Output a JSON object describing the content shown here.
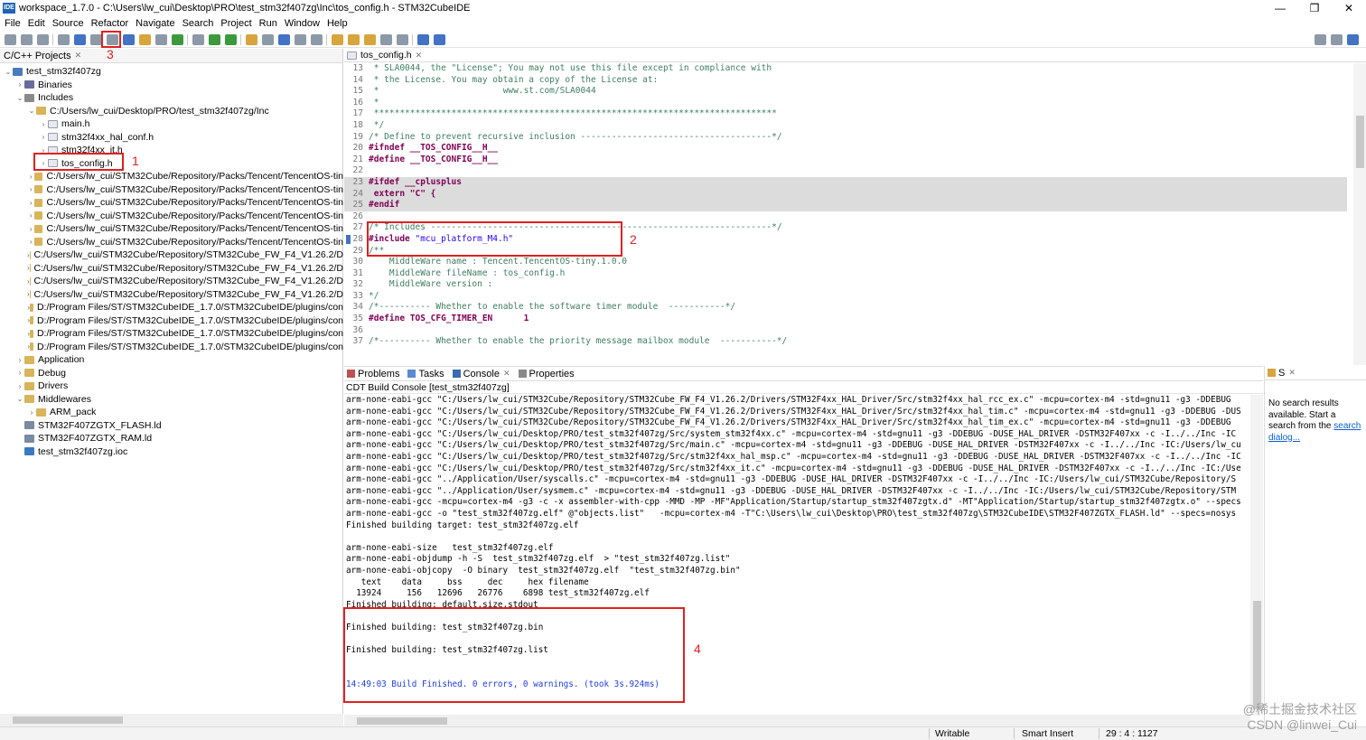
{
  "window": {
    "app_icon": "IDE",
    "title": "workspace_1.7.0 - C:\\Users\\lw_cui\\Desktop\\PRO\\test_stm32f407zg\\Inc\\tos_config.h - STM32CubeIDE",
    "minimize": "—",
    "maximize": "❐",
    "close": "✕"
  },
  "menu": [
    "File",
    "Edit",
    "Source",
    "Refactor",
    "Navigate",
    "Search",
    "Project",
    "Run",
    "Window",
    "Help"
  ],
  "project_explorer": {
    "title": "C/C++ Projects",
    "close_glyph": "✕",
    "tree": [
      {
        "label": "test_stm32f407zg",
        "indent": 0,
        "arrow": "⌄",
        "icon": "proj"
      },
      {
        "label": "Binaries",
        "indent": 1,
        "arrow": "›",
        "icon": "bin"
      },
      {
        "label": "Includes",
        "indent": 1,
        "arrow": "⌄",
        "icon": "inc"
      },
      {
        "label": "C:/Users/lw_cui/Desktop/PRO/test_stm32f407zg/Inc",
        "indent": 2,
        "arrow": "⌄",
        "icon": "folder"
      },
      {
        "label": "main.h",
        "indent": 3,
        "arrow": "›",
        "icon": "hfile"
      },
      {
        "label": "stm32f4xx_hal_conf.h",
        "indent": 3,
        "arrow": "›",
        "icon": "hfile"
      },
      {
        "label": "stm32f4xx_it.h",
        "indent": 3,
        "arrow": "›",
        "icon": "hfile"
      },
      {
        "label": "tos_config.h",
        "indent": 3,
        "arrow": "›",
        "icon": "hfile"
      },
      {
        "label": "C:/Users/lw_cui/STM32Cube/Repository/Packs/Tencent/TencentOS-tin",
        "indent": 2,
        "arrow": "›",
        "icon": "folder"
      },
      {
        "label": "C:/Users/lw_cui/STM32Cube/Repository/Packs/Tencent/TencentOS-tin",
        "indent": 2,
        "arrow": "›",
        "icon": "folder"
      },
      {
        "label": "C:/Users/lw_cui/STM32Cube/Repository/Packs/Tencent/TencentOS-tin",
        "indent": 2,
        "arrow": "›",
        "icon": "folder"
      },
      {
        "label": "C:/Users/lw_cui/STM32Cube/Repository/Packs/Tencent/TencentOS-tin",
        "indent": 2,
        "arrow": "›",
        "icon": "folder"
      },
      {
        "label": "C:/Users/lw_cui/STM32Cube/Repository/Packs/Tencent/TencentOS-tin",
        "indent": 2,
        "arrow": "›",
        "icon": "folder"
      },
      {
        "label": "C:/Users/lw_cui/STM32Cube/Repository/Packs/Tencent/TencentOS-tin",
        "indent": 2,
        "arrow": "›",
        "icon": "folder"
      },
      {
        "label": "C:/Users/lw_cui/STM32Cube/Repository/STM32Cube_FW_F4_V1.26.2/D",
        "indent": 2,
        "arrow": "›",
        "icon": "folder"
      },
      {
        "label": "C:/Users/lw_cui/STM32Cube/Repository/STM32Cube_FW_F4_V1.26.2/D",
        "indent": 2,
        "arrow": "›",
        "icon": "folder"
      },
      {
        "label": "C:/Users/lw_cui/STM32Cube/Repository/STM32Cube_FW_F4_V1.26.2/D",
        "indent": 2,
        "arrow": "›",
        "icon": "folder"
      },
      {
        "label": "C:/Users/lw_cui/STM32Cube/Repository/STM32Cube_FW_F4_V1.26.2/D",
        "indent": 2,
        "arrow": "›",
        "icon": "folder"
      },
      {
        "label": "D:/Program Files/ST/STM32CubeIDE_1.7.0/STM32CubeIDE/plugins/con",
        "indent": 2,
        "arrow": "›",
        "icon": "folder"
      },
      {
        "label": "D:/Program Files/ST/STM32CubeIDE_1.7.0/STM32CubeIDE/plugins/con",
        "indent": 2,
        "arrow": "›",
        "icon": "folder"
      },
      {
        "label": "D:/Program Files/ST/STM32CubeIDE_1.7.0/STM32CubeIDE/plugins/con",
        "indent": 2,
        "arrow": "›",
        "icon": "folder"
      },
      {
        "label": "D:/Program Files/ST/STM32CubeIDE_1.7.0/STM32CubeIDE/plugins/con",
        "indent": 2,
        "arrow": "›",
        "icon": "folder"
      },
      {
        "label": "Application",
        "indent": 1,
        "arrow": "›",
        "icon": "folder"
      },
      {
        "label": "Debug",
        "indent": 1,
        "arrow": "›",
        "icon": "folder"
      },
      {
        "label": "Drivers",
        "indent": 1,
        "arrow": "›",
        "icon": "folder"
      },
      {
        "label": "Middlewares",
        "indent": 1,
        "arrow": "⌄",
        "icon": "folder"
      },
      {
        "label": "ARM_pack",
        "indent": 2,
        "arrow": "›",
        "icon": "folder"
      },
      {
        "label": "STM32F407ZGTX_FLASH.ld",
        "indent": 1,
        "arrow": "",
        "icon": "ld"
      },
      {
        "label": "STM32F407ZGTX_RAM.ld",
        "indent": 1,
        "arrow": "",
        "icon": "ld"
      },
      {
        "label": "test_stm32f407zg.ioc",
        "indent": 1,
        "arrow": "",
        "icon": "ioc"
      }
    ]
  },
  "editor": {
    "tab_label": "tos_config.h",
    "tab_close": "✕",
    "lines": [
      {
        "n": "13",
        "t": " * SLA0044, the \"License\"; You may not use this file except in compliance with",
        "k": "cmt"
      },
      {
        "n": "14",
        "t": " * the License. You may obtain a copy of the License at:",
        "k": "cmt"
      },
      {
        "n": "15",
        "t": " *                        www.st.com/SLA0044",
        "k": "cmt"
      },
      {
        "n": "16",
        "t": " *",
        "k": "cmt"
      },
      {
        "n": "17",
        "t": " ******************************************************************************",
        "k": "cmt"
      },
      {
        "n": "18",
        "t": " */",
        "k": "cmt"
      },
      {
        "n": "19",
        "t": "/* Define to prevent recursive inclusion -------------------------------------*/",
        "k": "cmt"
      },
      {
        "n": "20",
        "t": "#ifndef __TOS_CONFIG__H__",
        "k": "kw"
      },
      {
        "n": "21",
        "t": "#define __TOS_CONFIG__H__",
        "k": "kw"
      },
      {
        "n": "22",
        "t": "",
        "k": ""
      },
      {
        "n": "23",
        "t": "#ifdef __cplusplus",
        "k": "kwhl"
      },
      {
        "n": "24",
        "t": " extern \"C\" {",
        "k": "kwhl"
      },
      {
        "n": "25",
        "t": "#endif",
        "k": "kwhl"
      },
      {
        "n": "26",
        "t": "",
        "k": ""
      },
      {
        "n": "27",
        "t": "/* Includes ------------------------------------------------------------------*/",
        "k": "cmt"
      },
      {
        "n": "28",
        "t": "#include \"mcu_platform_M4.h\"",
        "k": "inc"
      },
      {
        "n": "29",
        "t": "/**",
        "k": "cmt"
      },
      {
        "n": "30",
        "t": "    MiddleWare name : Tencent.TencentOS-tiny.1.0.0",
        "k": "cmt"
      },
      {
        "n": "31",
        "t": "    MiddleWare fileName : tos_config.h",
        "k": "cmt"
      },
      {
        "n": "32",
        "t": "    MiddleWare version :",
        "k": "cmt"
      },
      {
        "n": "33",
        "t": "*/",
        "k": "cmt"
      },
      {
        "n": "34",
        "t": "/*---------- Whether to enable the software timer module  -----------*/",
        "k": "cmt"
      },
      {
        "n": "35",
        "t": "#define TOS_CFG_TIMER_EN      1",
        "k": "kw"
      },
      {
        "n": "36",
        "t": "",
        "k": ""
      },
      {
        "n": "37",
        "t": "/*---------- Whether to enable the priority message mailbox module  -----------*/",
        "k": "cmt"
      }
    ]
  },
  "bottom_tabs": {
    "problems": "Problems",
    "tasks": "Tasks",
    "console": "Console",
    "console_close": "✕",
    "properties": "Properties"
  },
  "console": {
    "title": "CDT Build Console [test_stm32f407zg]",
    "lines": [
      {
        "t": "arm-none-eabi-gcc \"C:/Users/lw_cui/STM32Cube/Repository/STM32Cube_FW_F4_V1.26.2/Drivers/STM32F4xx_HAL_Driver/Src/stm32f4xx_hal_rcc_ex.c\" -mcpu=cortex-m4 -std=gnu11 -g3 -DDEBUG",
        "c": ""
      },
      {
        "t": "arm-none-eabi-gcc \"C:/Users/lw_cui/STM32Cube/Repository/STM32Cube_FW_F4_V1.26.2/Drivers/STM32F4xx_HAL_Driver/Src/stm32f4xx_hal_tim.c\" -mcpu=cortex-m4 -std=gnu11 -g3 -DDEBUG -DUS",
        "c": ""
      },
      {
        "t": "arm-none-eabi-gcc \"C:/Users/lw_cui/STM32Cube/Repository/STM32Cube_FW_F4_V1.26.2/Drivers/STM32F4xx_HAL_Driver/Src/stm32f4xx_hal_tim_ex.c\" -mcpu=cortex-m4 -std=gnu11 -g3 -DDEBUG",
        "c": ""
      },
      {
        "t": "arm-none-eabi-gcc \"C:/Users/lw_cui/Desktop/PRO/test_stm32f407zg/Src/system_stm32f4xx.c\" -mcpu=cortex-m4 -std=gnu11 -g3 -DDEBUG -DUSE_HAL_DRIVER -DSTM32F407xx -c -I../../Inc -IC",
        "c": ""
      },
      {
        "t": "arm-none-eabi-gcc \"C:/Users/lw_cui/Desktop/PRO/test_stm32f407zg/Src/main.c\" -mcpu=cortex-m4 -std=gnu11 -g3 -DDEBUG -DUSE_HAL_DRIVER -DSTM32F407xx -c -I../../Inc -IC:/Users/lw_cu",
        "c": ""
      },
      {
        "t": "arm-none-eabi-gcc \"C:/Users/lw_cui/Desktop/PRO/test_stm32f407zg/Src/stm32f4xx_hal_msp.c\" -mcpu=cortex-m4 -std=gnu11 -g3 -DDEBUG -DUSE_HAL_DRIVER -DSTM32F407xx -c -I../../Inc -IC",
        "c": ""
      },
      {
        "t": "arm-none-eabi-gcc \"C:/Users/lw_cui/Desktop/PRO/test_stm32f407zg/Src/stm32f4xx_it.c\" -mcpu=cortex-m4 -std=gnu11 -g3 -DDEBUG -DUSE_HAL_DRIVER -DSTM32F407xx -c -I../../Inc -IC:/Use",
        "c": ""
      },
      {
        "t": "arm-none-eabi-gcc \"../Application/User/syscalls.c\" -mcpu=cortex-m4 -std=gnu11 -g3 -DDEBUG -DUSE_HAL_DRIVER -DSTM32F407xx -c -I../../Inc -IC:/Users/lw_cui/STM32Cube/Repository/S",
        "c": ""
      },
      {
        "t": "arm-none-eabi-gcc \"../Application/User/sysmem.c\" -mcpu=cortex-m4 -std=gnu11 -g3 -DDEBUG -DUSE_HAL_DRIVER -DSTM32F407xx -c -I../../Inc -IC:/Users/lw_cui/STM32Cube/Repository/STM",
        "c": ""
      },
      {
        "t": "arm-none-eabi-gcc -mcpu=cortex-m4 -g3 -c -x assembler-with-cpp -MMD -MP -MF\"Application/Startup/startup_stm32f407zgtx.d\" -MT\"Application/Startup/startup_stm32f407zgtx.o\" --specs",
        "c": ""
      },
      {
        "t": "arm-none-eabi-gcc -o \"test_stm32f407zg.elf\" @\"objects.list\"   -mcpu=cortex-m4 -T\"C:\\Users\\lw_cui\\Desktop\\PRO\\test_stm32f407zg\\STM32CubeIDE\\STM32F407ZGTX_FLASH.ld\" --specs=nosys",
        "c": ""
      },
      {
        "t": "Finished building target: test_stm32f407zg.elf",
        "c": ""
      },
      {
        "t": " ",
        "c": ""
      },
      {
        "t": "arm-none-eabi-size   test_stm32f407zg.elf",
        "c": ""
      },
      {
        "t": "arm-none-eabi-objdump -h -S  test_stm32f407zg.elf  > \"test_stm32f407zg.list\"",
        "c": ""
      },
      {
        "t": "arm-none-eabi-objcopy  -O binary  test_stm32f407zg.elf  \"test_stm32f407zg.bin\"",
        "c": ""
      },
      {
        "t": "   text    data     bss     dec     hex filename",
        "c": ""
      },
      {
        "t": "  13924     156   12696   26776    6898 test_stm32f407zg.elf",
        "c": ""
      },
      {
        "t": "Finished building: default.size.stdout",
        "c": ""
      },
      {
        "t": " ",
        "c": ""
      },
      {
        "t": "Finished building: test_stm32f407zg.bin",
        "c": ""
      },
      {
        "t": " ",
        "c": ""
      },
      {
        "t": "Finished building: test_stm32f407zg.list",
        "c": ""
      },
      {
        "t": " ",
        "c": ""
      },
      {
        "t": " ",
        "c": ""
      },
      {
        "t": "14:49:03 Build Finished. 0 errors, 0 warnings. (took 3s.924ms)",
        "c": "blue"
      }
    ]
  },
  "search_panel": {
    "tab": "S",
    "text_1": "No search results available. Start a search from the ",
    "link": "search dialog...",
    "close_glyph": "✕"
  },
  "status": {
    "writable": "Writable",
    "insert_mode": "Smart Insert",
    "position": "29 : 4 : 1127"
  },
  "annotations": [
    "1",
    "2",
    "3",
    "4"
  ],
  "watermark": {
    "line1": "@稀土掘金技术社区",
    "line2": "CSDN @linwei_Cui"
  },
  "colors": {
    "annotation_red": "#e02020",
    "keyword": "#7f0055",
    "comment": "#3f7f5f",
    "string": "#2a00ff",
    "build_finished_blue": "#1f3ce8"
  }
}
